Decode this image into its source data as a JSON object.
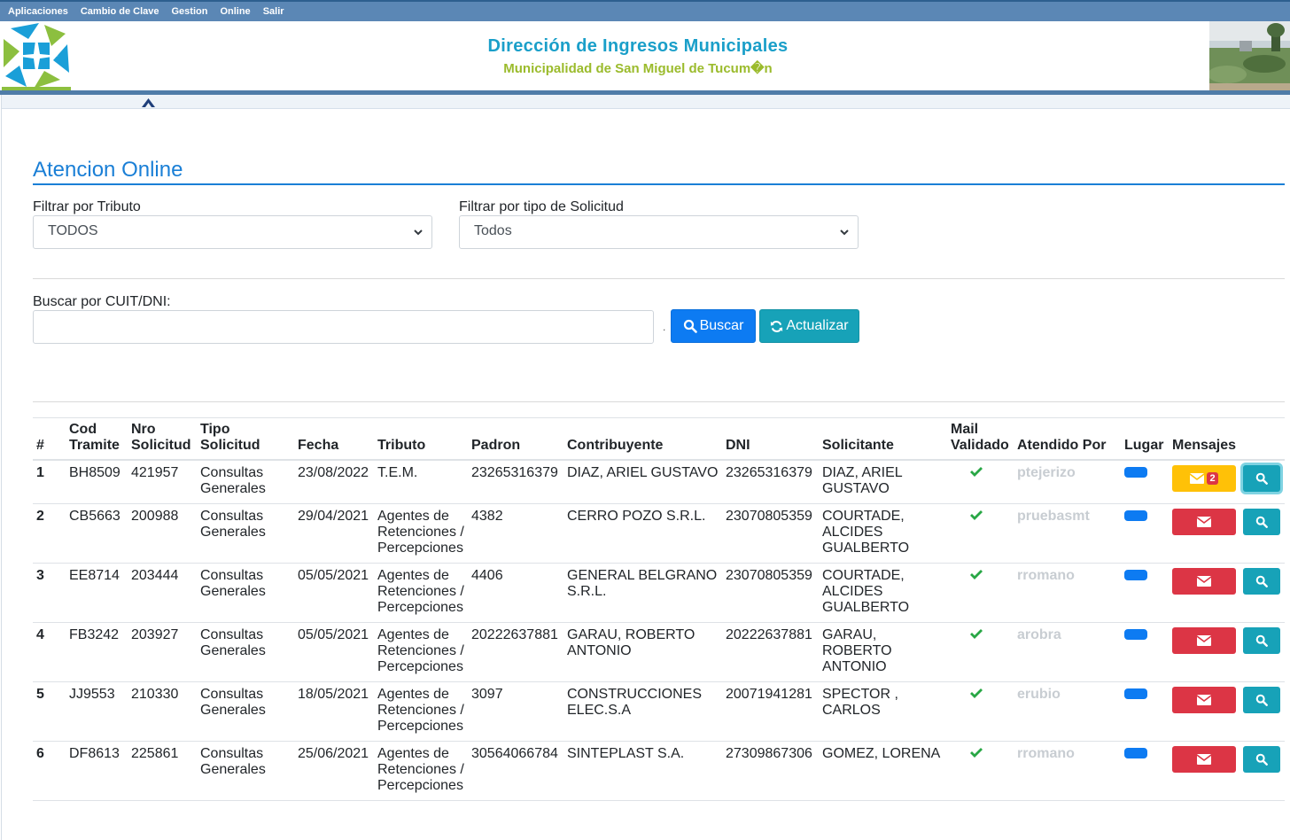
{
  "menu": [
    "Aplicaciones",
    "Cambio de Clave",
    "Gestion",
    "Online",
    "Salir"
  ],
  "header": {
    "title": "Dirección de Ingresos Municipales",
    "subtitle": "Municipalidad de San Miguel de Tucum�n"
  },
  "page_title": "Atencion Online",
  "filters": {
    "tributo_label": "Filtrar por Tributo",
    "tributo_value": "TODOS",
    "tipo_label": "Filtrar por tipo de Solicitud",
    "tipo_value": "Todos"
  },
  "search": {
    "label": "Buscar por CUIT/DNI:",
    "value": "",
    "separator": ".",
    "buscar": "Buscar",
    "actualizar": "Actualizar"
  },
  "colors": {
    "primary": "#0d7bf2",
    "info": "#17a2b8",
    "danger": "#dc3545",
    "warning": "#ffc107",
    "success": "#28a745",
    "title": "#1a9fc9",
    "subtitle": "#9bbb2c"
  },
  "table": {
    "headers": {
      "num": "#",
      "cod1": "Cod",
      "cod2": "Tramite",
      "nro1": "Nro",
      "nro2": "Solicitud",
      "tipo1": "Tipo",
      "tipo2": "Solicitud",
      "fecha": "Fecha",
      "tributo": "Tributo",
      "padron": "Padron",
      "contribuyente": "Contribuyente",
      "dni": "DNI",
      "solicitante": "Solicitante",
      "mail1": "Mail",
      "mail2": "Validado",
      "atendido": "Atendido Por",
      "lugar": "Lugar",
      "mensajes": "Mensajes"
    },
    "rows": [
      {
        "num": "1",
        "cod": "BH8509",
        "nro": "421957",
        "tipo": "Consultas Generales",
        "fecha": "23/08/2022",
        "tributo": "T.E.M.",
        "padron": "23265316379",
        "contribuyente": "DIAZ, ARIEL GUSTAVO",
        "dni": "23265316379",
        "solicitante": "DIAZ, ARIEL GUSTAVO",
        "atendido": "ptejerizo",
        "mensajes_count": "2"
      },
      {
        "num": "2",
        "cod": "CB5663",
        "nro": "200988",
        "tipo": "Consultas Generales",
        "fecha": "29/04/2021",
        "tributo": "Agentes de Retenciones / Percepciones",
        "padron": "4382",
        "contribuyente": "CERRO POZO S.R.L.",
        "dni": "23070805359",
        "solicitante": "COURTADE, ALCIDES GUALBERTO",
        "atendido": "pruebasmt",
        "mensajes_count": null
      },
      {
        "num": "3",
        "cod": "EE8714",
        "nro": "203444",
        "tipo": "Consultas Generales",
        "fecha": "05/05/2021",
        "tributo": "Agentes de Retenciones / Percepciones",
        "padron": "4406",
        "contribuyente": "GENERAL BELGRANO S.R.L.",
        "dni": "23070805359",
        "solicitante": "COURTADE, ALCIDES GUALBERTO",
        "atendido": "rromano",
        "mensajes_count": null
      },
      {
        "num": "4",
        "cod": "FB3242",
        "nro": "203927",
        "tipo": "Consultas Generales",
        "fecha": "05/05/2021",
        "tributo": "Agentes de Retenciones / Percepciones",
        "padron": "20222637881",
        "contribuyente": "GARAU, ROBERTO ANTONIO",
        "dni": "20222637881",
        "solicitante": "GARAU, ROBERTO ANTONIO",
        "atendido": "arobra",
        "mensajes_count": null
      },
      {
        "num": "5",
        "cod": "JJ9553",
        "nro": "210330",
        "tipo": "Consultas Generales",
        "fecha": "18/05/2021",
        "tributo": "Agentes de Retenciones / Percepciones",
        "padron": "3097",
        "contribuyente": "CONSTRUCCIONES ELEC.S.A",
        "dni": "20071941281",
        "solicitante": "SPECTOR , CARLOS",
        "atendido": "erubio",
        "mensajes_count": null
      },
      {
        "num": "6",
        "cod": "DF8613",
        "nro": "225861",
        "tipo": "Consultas Generales",
        "fecha": "25/06/2021",
        "tributo": "Agentes de Retenciones / Percepciones",
        "padron": "30564066784",
        "contribuyente": "SINTEPLAST S.A.",
        "dni": "27309867306",
        "solicitante": "GOMEZ, LORENA",
        "atendido": "rromano",
        "mensajes_count": null
      }
    ]
  }
}
